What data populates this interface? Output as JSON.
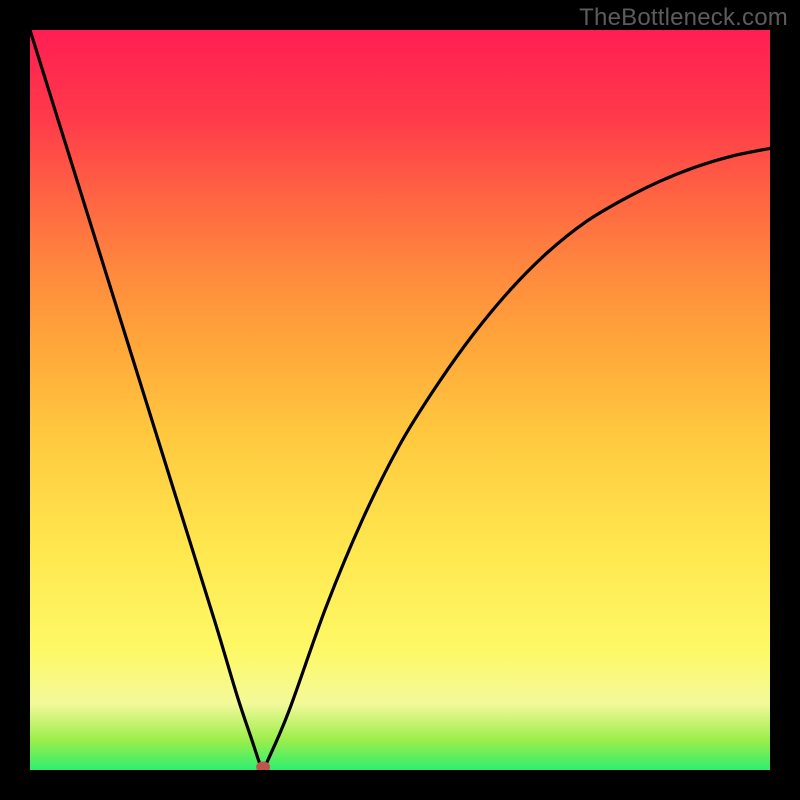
{
  "attribution": "TheBottleneck.com",
  "chart_data": {
    "type": "line",
    "title": "",
    "xlabel": "",
    "ylabel": "",
    "xlim": [
      0,
      100
    ],
    "ylim": [
      0,
      100
    ],
    "grid": false,
    "annotations": [],
    "series": [
      {
        "name": "curve",
        "x": [
          0,
          5,
          10,
          15,
          20,
          25,
          28,
          30,
          31,
          31.5,
          32,
          35,
          40,
          45,
          50,
          55,
          60,
          65,
          70,
          75,
          80,
          85,
          90,
          95,
          100
        ],
        "values": [
          100,
          84,
          68,
          52,
          36,
          20,
          10,
          4,
          1,
          0,
          1,
          8,
          22,
          34,
          44,
          52,
          59,
          65,
          70,
          74,
          77,
          79.5,
          81.5,
          83,
          84
        ]
      }
    ],
    "marker": {
      "x": 31.5,
      "y": 0
    },
    "gradient_stops": [
      {
        "pos": 0,
        "color": "#2eee71"
      },
      {
        "pos": 4,
        "color": "#9aee4b"
      },
      {
        "pos": 9,
        "color": "#f3f99a"
      },
      {
        "pos": 16,
        "color": "#fef967"
      },
      {
        "pos": 30,
        "color": "#ffe74e"
      },
      {
        "pos": 45,
        "color": "#ffc93f"
      },
      {
        "pos": 58,
        "color": "#ffa53a"
      },
      {
        "pos": 68,
        "color": "#ff873e"
      },
      {
        "pos": 78,
        "color": "#ff6243"
      },
      {
        "pos": 88,
        "color": "#ff3a4a"
      },
      {
        "pos": 100,
        "color": "#ff1e53"
      }
    ],
    "marker_color": "#c1554e",
    "curve_color": "#000000",
    "curve_width": 3.2
  }
}
